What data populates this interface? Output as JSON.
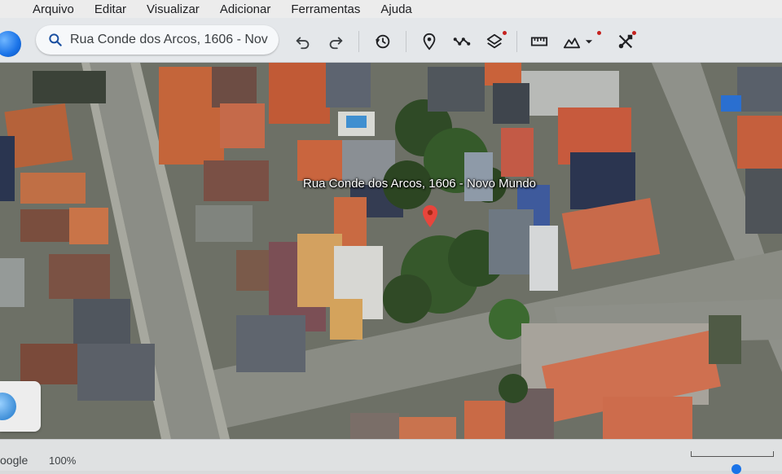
{
  "menu": {
    "items": [
      "Arquivo",
      "Editar",
      "Visualizar",
      "Adicionar",
      "Ferramentas",
      "Ajuda"
    ]
  },
  "toolbar": {
    "search_value": "Rua Conde dos Arcos, 1606 - Nov",
    "icons": [
      "search-icon",
      "undo-icon",
      "redo-icon",
      "historical-imagery-icon",
      "placemark-icon",
      "path-icon",
      "layers-icon",
      "ruler-icon",
      "elevation-profile-icon",
      "hide-sidebar-icon"
    ]
  },
  "map": {
    "place_label": "Rua Conde dos Arcos, 1606 - Novo Mundo",
    "pin_color": "#e8453c"
  },
  "status": {
    "brand": "oogle",
    "zoom": "100%"
  },
  "colors": {
    "accent": "#1a73e8",
    "notification_dot": "#c5221f"
  }
}
